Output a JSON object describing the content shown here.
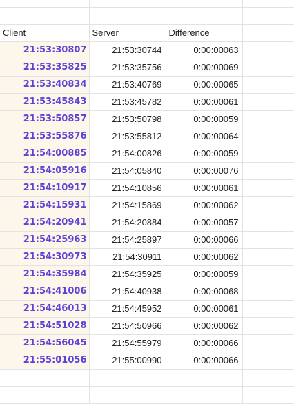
{
  "sheet": {
    "headers": {
      "client": "Client",
      "server": "Server",
      "difference": "Difference"
    },
    "rows": [
      {
        "client": "21:53:30807",
        "server": "21:53:30744",
        "difference": "0:00:00063"
      },
      {
        "client": "21:53:35825",
        "server": "21:53:35756",
        "difference": "0:00:00069"
      },
      {
        "client": "21:53:40834",
        "server": "21:53:40769",
        "difference": "0:00:00065"
      },
      {
        "client": "21:53:45843",
        "server": "21:53:45782",
        "difference": "0:00:00061"
      },
      {
        "client": "21:53:50857",
        "server": "21:53:50798",
        "difference": "0:00:00059"
      },
      {
        "client": "21:53:55876",
        "server": "21:53:55812",
        "difference": "0:00:00064"
      },
      {
        "client": "21:54:00885",
        "server": "21:54:00826",
        "difference": "0:00:00059"
      },
      {
        "client": "21:54:05916",
        "server": "21:54:05840",
        "difference": "0:00:00076"
      },
      {
        "client": "21:54:10917",
        "server": "21:54:10856",
        "difference": "0:00:00061"
      },
      {
        "client": "21:54:15931",
        "server": "21:54:15869",
        "difference": "0:00:00062"
      },
      {
        "client": "21:54:20941",
        "server": "21:54:20884",
        "difference": "0:00:00057"
      },
      {
        "client": "21:54:25963",
        "server": "21:54:25897",
        "difference": "0:00:00066"
      },
      {
        "client": "21:54:30973",
        "server": "21:54:30911",
        "difference": "0:00:00062"
      },
      {
        "client": "21:54:35984",
        "server": "21:54:35925",
        "difference": "0:00:00059"
      },
      {
        "client": "21:54:41006",
        "server": "21:54:40938",
        "difference": "0:00:00068"
      },
      {
        "client": "21:54:46013",
        "server": "21:54:45952",
        "difference": "0:00:00061"
      },
      {
        "client": "21:54:51028",
        "server": "21:54:50966",
        "difference": "0:00:00062"
      },
      {
        "client": "21:54:56045",
        "server": "21:54:55979",
        "difference": "0:00:00066"
      },
      {
        "client": "21:55:01056",
        "server": "21:55:00990",
        "difference": "0:00:00066"
      }
    ],
    "colors": {
      "client_text": "#5b43d6",
      "client_fill": "#fdf6ea",
      "gridline": "#e2e2e2",
      "text": "#222222"
    }
  }
}
